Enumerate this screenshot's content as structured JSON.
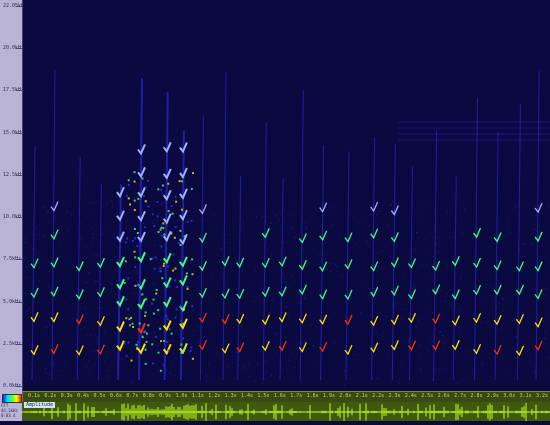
{
  "frequency_ruler": {
    "labels": [
      "22.05kHz",
      "20.0kHz",
      "17.5kHz",
      "15.0kHz",
      "12.5kHz",
      "10.0kHz",
      "7.5kHz",
      "5.0kHz",
      "2.5kHz",
      "0.0kHz"
    ]
  },
  "time_ruler": {
    "labels": [
      "0.1s",
      "0.2s",
      "0.3s",
      "0.4s",
      "0.5s",
      "0.6s",
      "0.7s",
      "0.8s",
      "0.9s",
      "1.0s",
      "1.1s",
      "1.2s",
      "1.3s",
      "1.4s",
      "1.5s",
      "1.6s",
      "1.7s",
      "1.8s",
      "1.9s",
      "2.0s",
      "2.1s",
      "2.2s",
      "2.3s",
      "2.4s",
      "2.5s",
      "2.6s",
      "2.7s",
      "2.8s",
      "2.9s",
      "3.0s",
      "3.1s",
      "3.2s"
    ]
  },
  "corner_panel": {
    "line1": "FFT",
    "line2": "44.1kHz",
    "line3": "0:03.4"
  },
  "waveform": {
    "label": "Amplitude"
  },
  "colors": {
    "background": "#0a0a40",
    "low": "#3030ff",
    "mid": "#40ff80",
    "high": "#ffe000",
    "peak": "#ff3000",
    "waveform": "#c8ff20"
  }
}
